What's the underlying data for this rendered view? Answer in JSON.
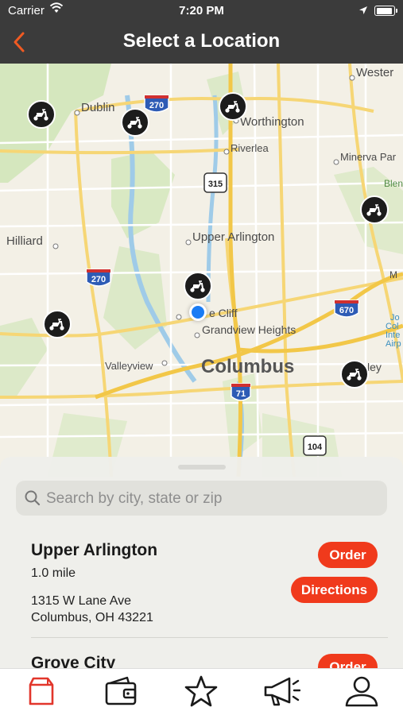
{
  "status_bar": {
    "carrier": "Carrier",
    "time": "7:20 PM"
  },
  "nav": {
    "title": "Select a Location",
    "back_icon": "chevron-left-icon"
  },
  "colors": {
    "accent": "#f03a1c",
    "nav_bg": "#3b3b3b",
    "user_dot": "#1a7cf4",
    "tab_active": "#e2362b"
  },
  "map": {
    "labels": {
      "dublin": "Dublin",
      "worthington": "Worthington",
      "western": "Wester",
      "riverlea": "Riverlea",
      "minerva": "Minerva Par",
      "blen": "Blen",
      "m": "M",
      "hilliard": "Hilliard",
      "upper_arlington": "Upper Arlington",
      "marble_cliff": "e Cliff",
      "grandview": "Grandview Heights",
      "valleyview": "Valleyview",
      "columbus": "Columbus",
      "bexley": "ley",
      "jo": "Jo",
      "col": "Col",
      "inte": "Inte",
      "airp": "Airp"
    },
    "shields": {
      "i270_north": "270",
      "i270_west": "270",
      "i670": "670",
      "i71": "71",
      "sr315": "315",
      "sr104": "104"
    }
  },
  "search": {
    "placeholder": "Search by city, state or zip"
  },
  "locations": [
    {
      "name": "Upper Arlington",
      "distance": "1.0 mile",
      "street": "1315 W Lane Ave",
      "city": "Columbus, OH 43221",
      "order_label": "Order",
      "directions_label": "Directions"
    },
    {
      "name": "Grove City",
      "order_label": "Order"
    }
  ],
  "tabs": [
    {
      "icon": "bag-icon",
      "active": true
    },
    {
      "icon": "wallet-icon",
      "active": false
    },
    {
      "icon": "star-icon",
      "active": false
    },
    {
      "icon": "megaphone-icon",
      "active": false
    },
    {
      "icon": "profile-icon",
      "active": false
    }
  ]
}
